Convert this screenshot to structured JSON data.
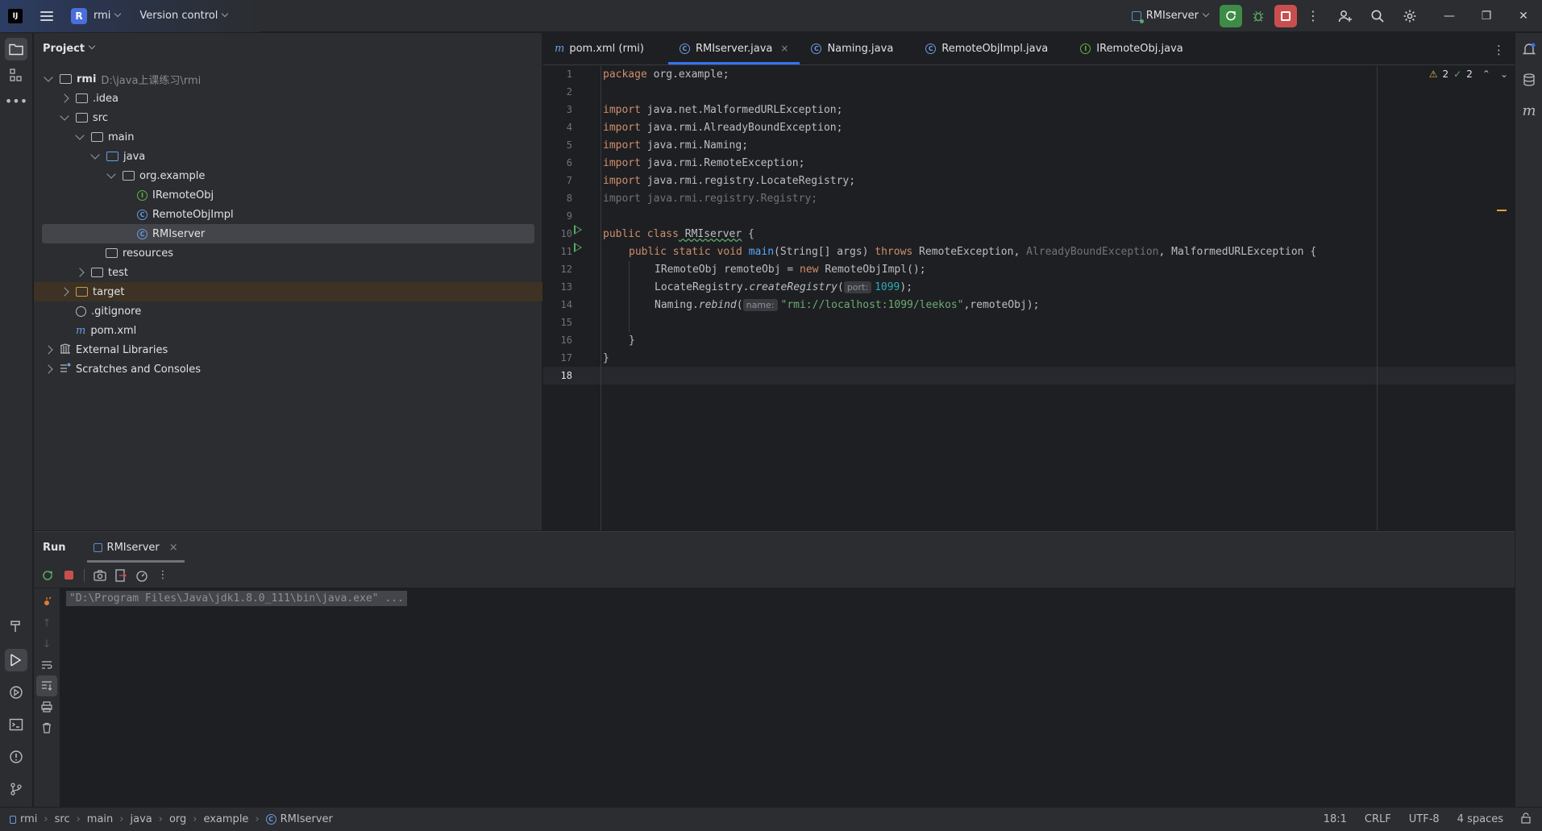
{
  "titlebar": {
    "project_badge": "R",
    "project_name": "rmi",
    "version_control": "Version control",
    "run_config": "RMIserver"
  },
  "project_panel": {
    "title": "Project",
    "tree": [
      {
        "label": "rmi",
        "extra": "D:\\java上课练习\\rmi",
        "kind": "module"
      },
      {
        "label": ".idea",
        "kind": "folder"
      },
      {
        "label": "src",
        "kind": "folder"
      },
      {
        "label": "main",
        "kind": "folder"
      },
      {
        "label": "java",
        "kind": "folder-blue"
      },
      {
        "label": "org.example",
        "kind": "package"
      },
      {
        "label": "IRemoteObj",
        "kind": "interface"
      },
      {
        "label": "RemoteObjImpl",
        "kind": "class"
      },
      {
        "label": "RMIserver",
        "kind": "class"
      },
      {
        "label": "resources",
        "kind": "folder"
      },
      {
        "label": "test",
        "kind": "folder"
      },
      {
        "label": "target",
        "kind": "folder"
      },
      {
        "label": ".gitignore",
        "kind": "file"
      },
      {
        "label": "pom.xml",
        "kind": "maven"
      },
      {
        "label": "External Libraries",
        "kind": "libraries"
      },
      {
        "label": "Scratches and Consoles",
        "kind": "scratches"
      }
    ]
  },
  "editor": {
    "tabs": [
      {
        "label": "pom.xml (rmi)",
        "icon": "maven-icon"
      },
      {
        "label": "RMIserver.java",
        "icon": "class-icon",
        "active": true,
        "close": "×"
      },
      {
        "label": "Naming.java",
        "icon": "class-icon"
      },
      {
        "label": "RemoteObjImpl.java",
        "icon": "class-icon"
      },
      {
        "label": "IRemoteObj.java",
        "icon": "interface-icon"
      }
    ],
    "warnings": "2",
    "checks": "2",
    "line_numbers": [
      "1",
      "2",
      "3",
      "4",
      "5",
      "6",
      "7",
      "8",
      "9",
      "10",
      "11",
      "12",
      "13",
      "14",
      "15",
      "16",
      "17",
      "18"
    ],
    "code": {
      "l1_kw": "package",
      "l1_rest": " org.example;",
      "import_kw": "import",
      "l3": " java.net.MalformedURLException;",
      "l4": " java.rmi.AlreadyBoundException;",
      "l5": " java.rmi.Naming;",
      "l6": " java.rmi.RemoteException;",
      "l7": " java.rmi.registry.LocateRegistry;",
      "l8": " java.rmi.registry.Registry;",
      "l10_kw": "public class",
      "l10_name": " RMIserver",
      "l10_rest": " {",
      "l11_kw": "public static void",
      "l11_fn": " main",
      "l11_a": "(String[] args) ",
      "l11_throws": "throws",
      "l11_b": " RemoteException, ",
      "l11_dim": "AlreadyBoundException",
      "l11_c": ", MalformedURLException {",
      "l12_a": "IRemoteObj remoteObj = ",
      "l12_new": "new",
      "l12_b": " RemoteObjImpl();",
      "l13_a": "LocateRegistry.",
      "l13_fn": "createRegistry",
      "l13_b": "(",
      "l13_hint": "port:",
      "l13_num": "1099",
      "l13_c": ");",
      "l14_a": "Naming.",
      "l14_fn": "rebind",
      "l14_b": "(",
      "l14_hint": "name:",
      "l14_str": "\"rmi://localhost:1099/leekos\"",
      "l14_c": ",remoteObj);",
      "l16": "}",
      "l17": "}"
    }
  },
  "run_panel": {
    "title": "Run",
    "tab": "RMIserver",
    "tab_close": "×",
    "command": "\"D:\\Program Files\\Java\\jdk1.8.0_111\\bin\\java.exe\" ..."
  },
  "statusbar": {
    "breadcrumbs": [
      "rmi",
      "src",
      "main",
      "java",
      "org",
      "example",
      "RMIserver"
    ],
    "position": "18:1",
    "line_sep": "CRLF",
    "encoding": "UTF-8",
    "indent": "4 spaces"
  }
}
